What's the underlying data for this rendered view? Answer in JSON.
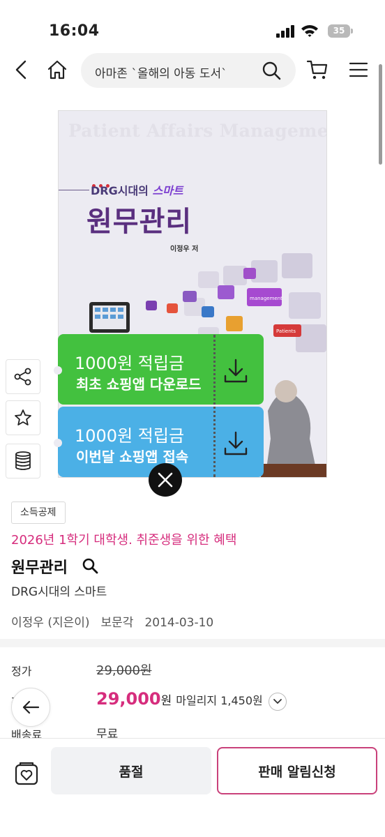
{
  "status_bar": {
    "time": "16:04",
    "battery": "35"
  },
  "nav": {
    "search_text": "아마존 `올해의 아동 도서`",
    "icons": [
      "back-icon",
      "home-icon",
      "search-icon",
      "cart-icon",
      "menu-icon"
    ]
  },
  "cover": {
    "english_title": "Patient Affairs Management",
    "subtitle_prefix": "DRG시대의 ",
    "subtitle_smart": "스마트",
    "main_title": "원무관리",
    "author": "이정우 저",
    "tile_labels": [
      "management",
      "Patients"
    ]
  },
  "banners": {
    "download": {
      "line1": "1000원 적립금",
      "line2": "최초 쇼핑앱 다운로드"
    },
    "visit": {
      "line1": "1000원 적립금",
      "line2": "이번달 쇼핑앱 접속"
    }
  },
  "product": {
    "tag": "소득공제",
    "promo": "2026년 1학기 대학생. 취준생을 위한 혜택",
    "title": "원무관리",
    "subtitle": "DRG시대의 스마트",
    "author": "이정우 (지은이)",
    "publisher": "보문각",
    "date": "2014-03-10"
  },
  "price": {
    "list_label": "정가",
    "list_value": "29,000원",
    "sale_label": "판",
    "sale_value": "29,000",
    "sale_unit": "원",
    "mileage": "마일리지 1,450원",
    "shipping_label": "배송료",
    "shipping_value": "무료"
  },
  "bottom_bar": {
    "soldout": "품절",
    "notify": "판매 알림신청"
  },
  "colors": {
    "accent": "#d62d7d",
    "green_banner": "#43c13f",
    "blue_banner": "#4bb0e6",
    "title_purple": "#5a2f7f"
  }
}
